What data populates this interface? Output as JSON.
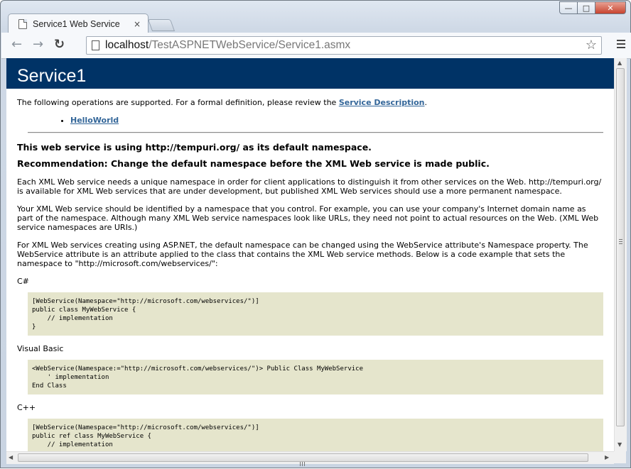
{
  "browser": {
    "tab_title": "Service1 Web Service",
    "tab_close": "×",
    "url_host": "localhost",
    "url_path": "/TestASPNETWebService/Service1.asmx",
    "back_icon": "←",
    "forward_icon": "→",
    "reload_icon": "↻",
    "star_icon": "☆",
    "window_min": "—",
    "window_max": "□",
    "window_close": "✕"
  },
  "page": {
    "heading": "Service1",
    "intro_text": "The following operations are supported. For a formal definition, please review the ",
    "service_description_link": "Service Description",
    "intro_end": ".",
    "operations": [
      "HelloWorld"
    ],
    "namespace_notice": "This web service is using http://tempuri.org/ as its default namespace.",
    "recommendation": "Recommendation: Change the default namespace before the XML Web service is made public.",
    "para1": "Each XML Web service needs a unique namespace in order for client applications to distinguish it from other services on the Web. http://tempuri.org/ is available for XML Web services that are under development, but published XML Web services should use a more permanent namespace.",
    "para2": "Your XML Web service should be identified by a namespace that you control. For example, you can use your company's Internet domain name as part of the namespace. Although many XML Web service namespaces look like URLs, they need not point to actual resources on the Web. (XML Web service namespaces are URIs.)",
    "para3": "For XML Web services creating using ASP.NET, the default namespace can be changed using the WebService attribute's Namespace property. The WebService attribute is an attribute applied to the class that contains the XML Web service methods. Below is a code example that sets the namespace to \"http://microsoft.com/webservices/\":",
    "code_samples": [
      {
        "language": "C#",
        "code": "[WebService(Namespace=\"http://microsoft.com/webservices/\")]\npublic class MyWebService {\n    // implementation\n}"
      },
      {
        "language": "Visual Basic",
        "code": "<WebService(Namespace:=\"http://microsoft.com/webservices/\")> Public Class MyWebService\n    ' implementation\nEnd Class"
      },
      {
        "language": "C++",
        "code": "[WebService(Namespace=\"http://microsoft.com/webservices/\")]\npublic ref class MyWebService {\n    // implementation"
      }
    ]
  }
}
